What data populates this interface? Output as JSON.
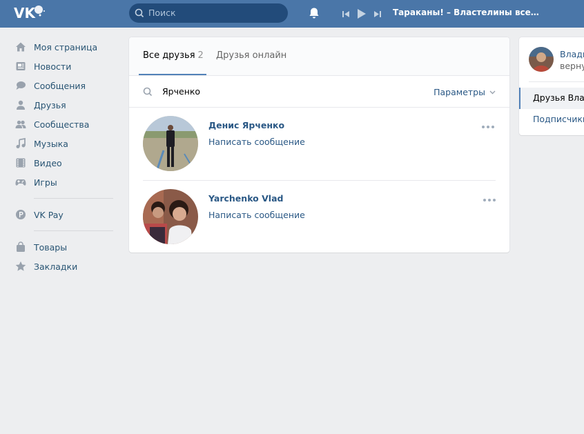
{
  "header": {
    "search_placeholder": "Поиск",
    "now_playing": "Тараканы! – Властелины вселенн..."
  },
  "sidebar": {
    "items": [
      {
        "label": "Моя страница",
        "icon": "home-icon"
      },
      {
        "label": "Новости",
        "icon": "news-icon"
      },
      {
        "label": "Сообщения",
        "icon": "messages-icon"
      },
      {
        "label": "Друзья",
        "icon": "friends-icon"
      },
      {
        "label": "Сообщества",
        "icon": "communities-icon"
      },
      {
        "label": "Музыка",
        "icon": "music-icon"
      },
      {
        "label": "Видео",
        "icon": "video-icon"
      },
      {
        "label": "Игры",
        "icon": "games-icon"
      }
    ],
    "pay": {
      "label": "VK Pay",
      "icon": "vkpay-icon"
    },
    "extra": [
      {
        "label": "Товары",
        "icon": "shopping-bag-icon"
      },
      {
        "label": "Закладки",
        "icon": "star-icon"
      }
    ]
  },
  "main": {
    "tabs": [
      {
        "label": "Все друзья",
        "count": "2"
      },
      {
        "label": "Друзья онлайн"
      }
    ],
    "search_value": "Ярченко",
    "params_label": "Параметры",
    "friends": [
      {
        "name": "Денис Ярченко",
        "action": "Написать сообщение"
      },
      {
        "name": "Yarchenko Vlad",
        "action": "Написать сообщение"
      }
    ]
  },
  "right": {
    "name": "Влади",
    "subtitle": "верну",
    "items": [
      "Друзья Влад",
      "Подписчики"
    ]
  },
  "colors": {
    "header_bg": "#4a76a8",
    "link": "#2a5885",
    "page_bg": "#edeef0"
  }
}
